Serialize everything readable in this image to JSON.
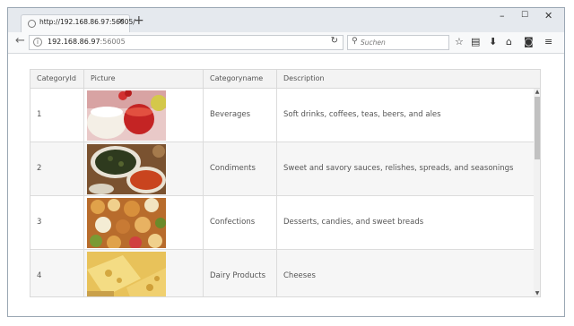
{
  "browser": {
    "tab_title": "http://192.168.86.97:56005/",
    "tab_close": "×",
    "new_tab": "+",
    "minimize": "–",
    "maximize": "☐",
    "close": "✕",
    "url_host": "192.168.86.97",
    "url_port": ":56005",
    "search_placeholder": "Suchen"
  },
  "grid": {
    "columns": [
      "CategoryId",
      "Picture",
      "Categoryname",
      "Description"
    ],
    "rows": [
      {
        "id": "1",
        "name": "Beverages",
        "description": "Soft drinks, coffees, teas, beers, and ales",
        "picture": "beverages-image"
      },
      {
        "id": "2",
        "name": "Condiments",
        "description": "Sweet and savory sauces, relishes, spreads, and seasonings",
        "picture": "condiments-image"
      },
      {
        "id": "3",
        "name": "Confections",
        "description": "Desserts, candies, and sweet breads",
        "picture": "confections-image"
      },
      {
        "id": "4",
        "name": "Dairy Products",
        "description": "Cheeses",
        "picture": "dairy-image"
      }
    ]
  }
}
